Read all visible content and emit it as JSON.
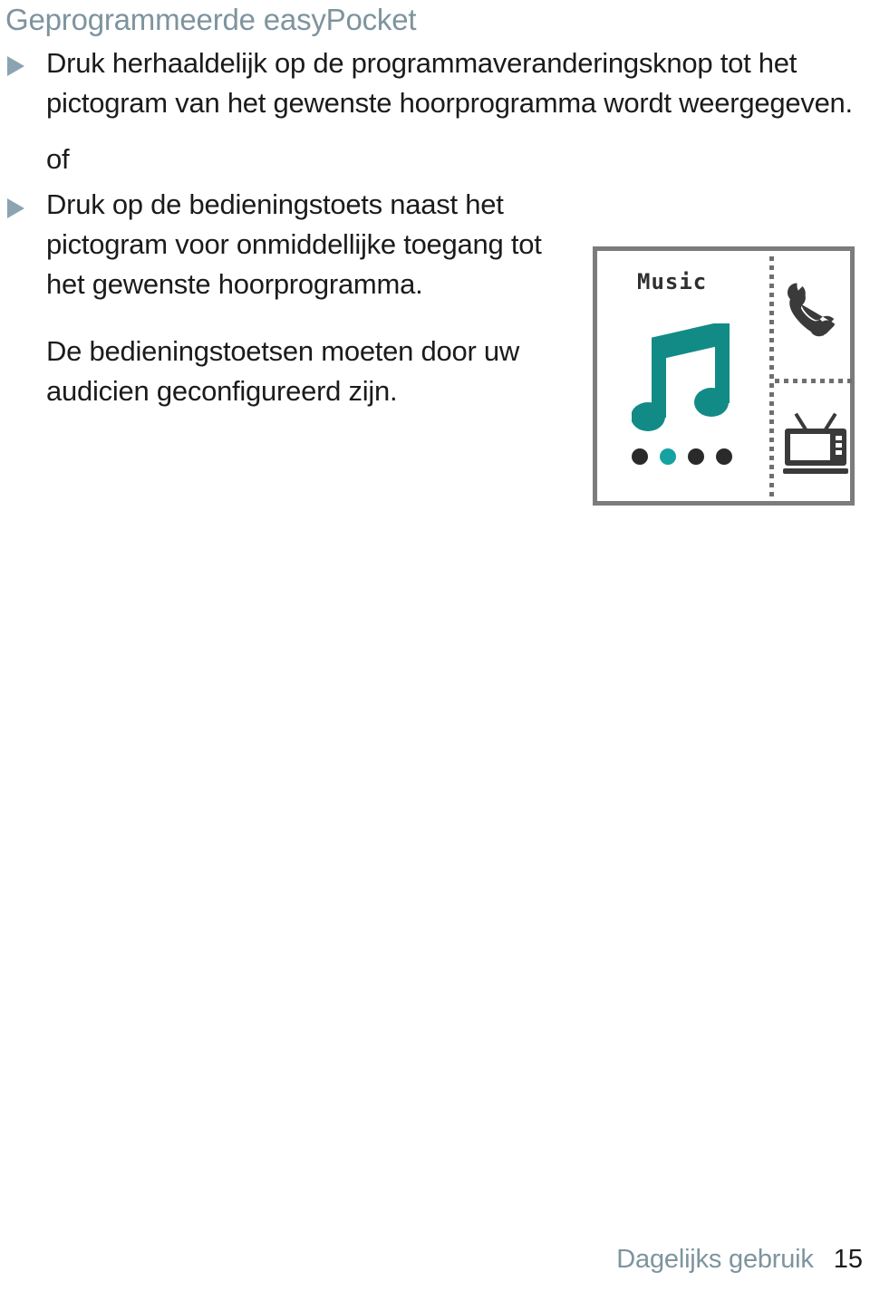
{
  "document": {
    "heading": "Geprogrammeerde easyPocket",
    "blocks": [
      {
        "type": "bullet",
        "marker": "triangle-right",
        "text": "Druk herhaaldelijk op de programmaveranderingsknop tot het pictogram van het gewenste hoorprogramma wordt weergegeven."
      },
      {
        "type": "plain",
        "text": "of"
      },
      {
        "type": "bullet",
        "marker": "triangle-right",
        "text": "Druk op de bedieningstoets naast het pictogram voor onmiddellijke toegang tot het gewenste hoorprogramma."
      },
      {
        "type": "note",
        "text": "De bedieningstoetsen moeten door uw audicien geconfigureerd zijn."
      }
    ]
  },
  "illustration": {
    "name": "easypocket-display-illustration",
    "screen_label": "Music",
    "icons": {
      "music_note": "music-note-icon",
      "phone": "telephone-handset-icon",
      "tv": "television-icon"
    },
    "program_dots": [
      {
        "label": "program-1",
        "active": false
      },
      {
        "label": "program-2",
        "active": true
      },
      {
        "label": "program-3",
        "active": false
      },
      {
        "label": "program-4",
        "active": false
      }
    ],
    "dividers": {
      "vertical": "dotted-vertical-divider",
      "horizontal": "dotted-horizontal-divider"
    }
  },
  "footer": {
    "section": "Dagelijks gebruik",
    "page_number": "15"
  },
  "colors": {
    "heading": "#7e949e",
    "body_text": "#1b1b1b",
    "bullet_marker": "#8ba4b2",
    "accent_teal": "#128b86",
    "active_dot_teal": "#16a2a0",
    "icon_dark": "#3a3a3a",
    "box_border": "#7c7c7c",
    "divider_dots": "#6f6f6f",
    "footer_section": "#7e949e",
    "page_background": "#ffffff"
  }
}
